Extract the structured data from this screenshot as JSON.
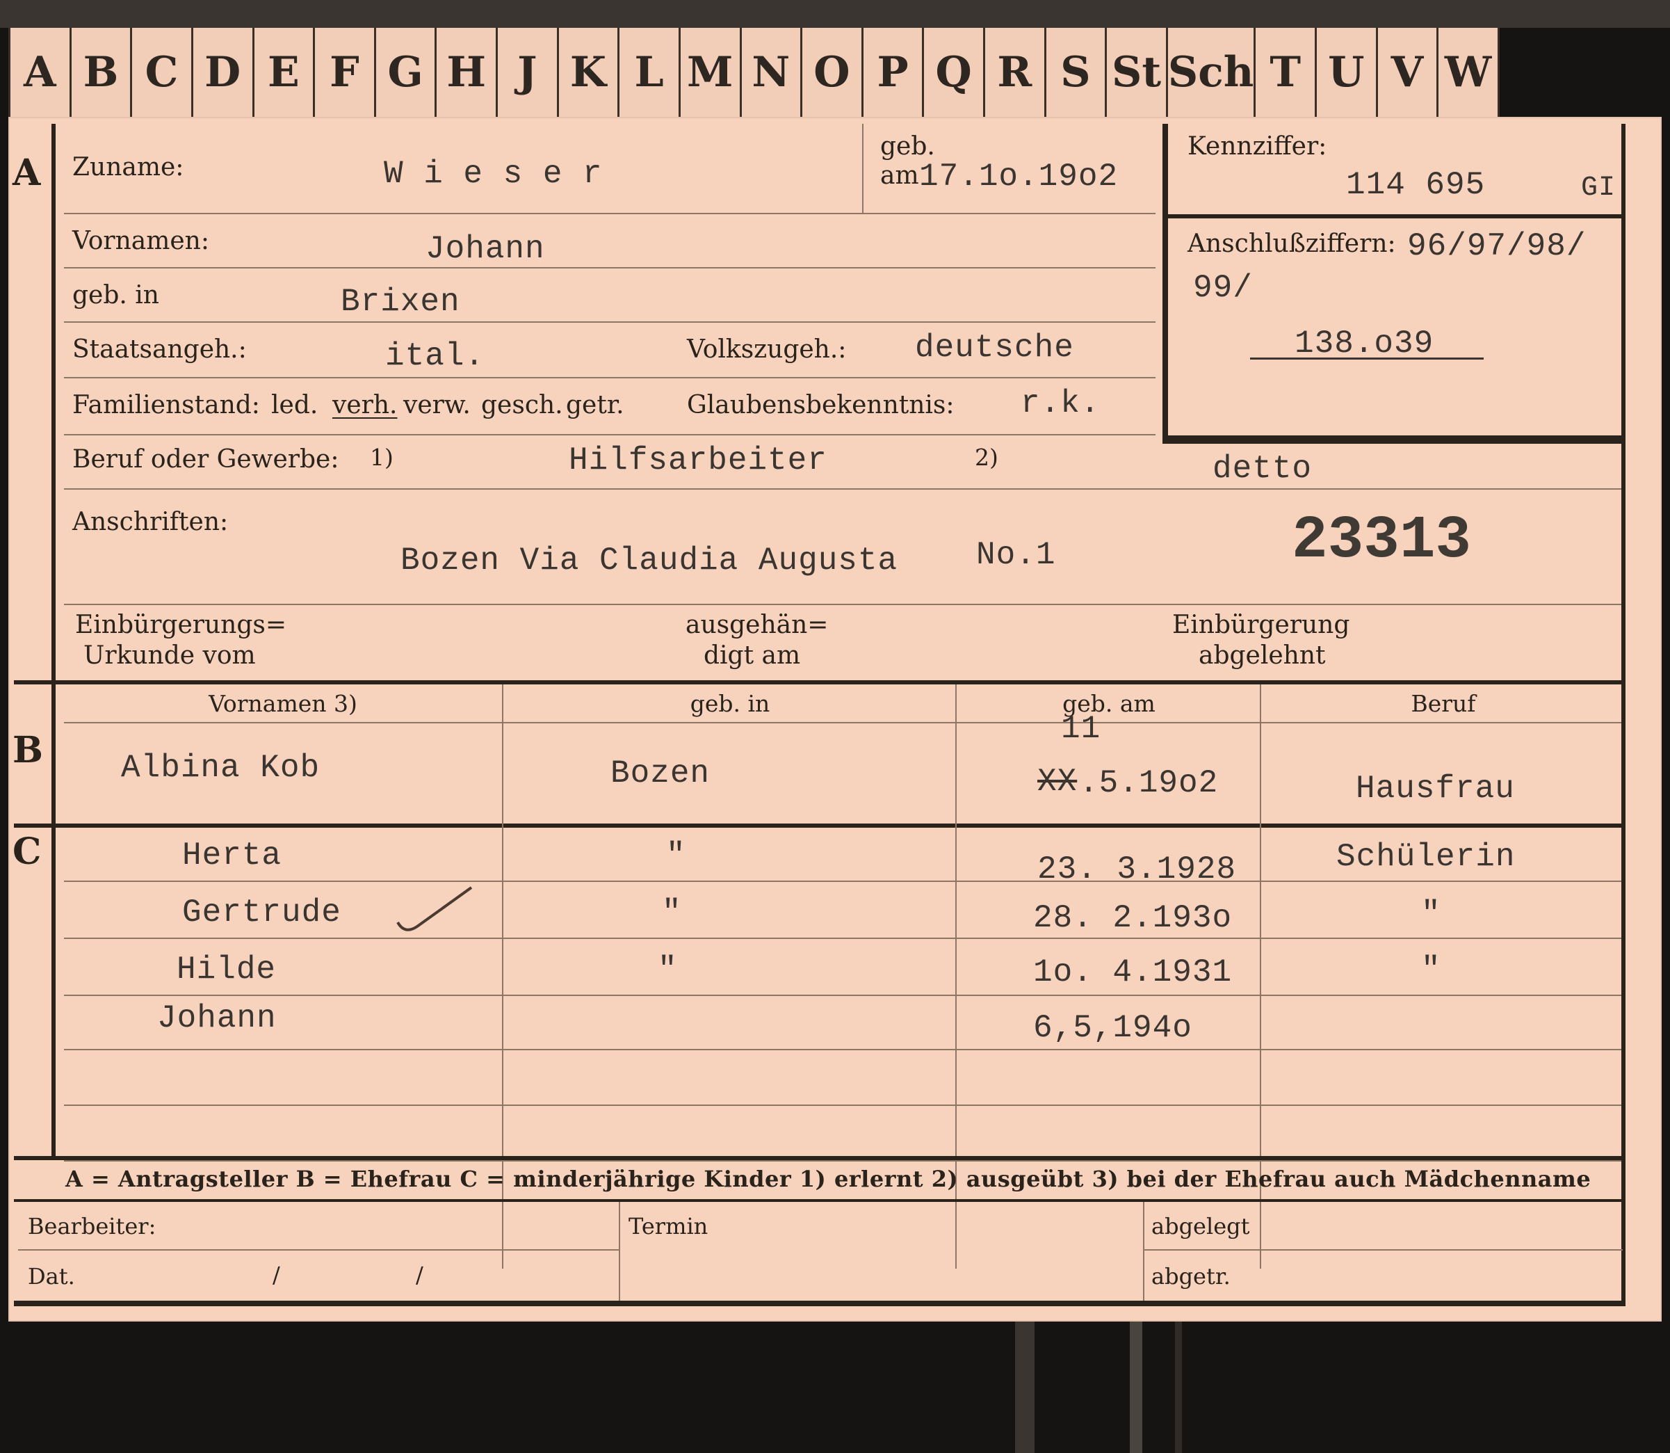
{
  "tabs": [
    "A",
    "B",
    "C",
    "D",
    "E",
    "F",
    "G",
    "H",
    "J",
    "K",
    "L",
    "M",
    "N",
    "O",
    "P",
    "Q",
    "R",
    "S",
    "St",
    "Sch",
    "T",
    "U",
    "V",
    "W"
  ],
  "section_a": {
    "letter": "A",
    "surname_label": "Zuname:",
    "surname": "W i e s e r",
    "born_label_1": "geb.",
    "born_label_2": "am",
    "born_date": "17.1o.19o2",
    "kennziffer_label": "Kennziffer:",
    "kennziffer": "114 695",
    "kennziffer_suffix": "GI",
    "anschluss_label": "Anschlußziffern:",
    "anschluss_1": "96/97/98/",
    "anschluss_2": "99/",
    "anschluss_3": "138.o39",
    "vornamen_label": "Vornamen:",
    "vornamen": "Johann",
    "birthplace_label": "geb. in",
    "birthplace": "Brixen",
    "citizenship_label": "Staatsangeh.:",
    "citizenship": "ital.",
    "ethnicity_label": "Volkszugeh.:",
    "ethnicity": "deutsche",
    "marital_label": "Familienstand:",
    "marital_options": [
      "led.",
      "verh.",
      "verw.",
      "gesch.",
      "getr."
    ],
    "religion_label": "Glaubensbekenntnis:",
    "religion": "r.k.",
    "occupation_label": "Beruf oder Gewerbe:",
    "occ_note_1": "1)",
    "occupation_learned": "Hilfsarbeiter",
    "occ_note_2": "2)",
    "occupation_practiced": "detto",
    "address_label": "Anschriften:",
    "address": "Bozen Via Claudia Augusta",
    "address_no": "No.1",
    "stamp_number": "23313",
    "naturalization_label_1": "Einbürgerungs=",
    "naturalization_label_2": "Urkunde vom",
    "handed_label_1": "ausgehän=",
    "handed_label_2": "digt am",
    "refused_label_1": "Einbürgerung",
    "refused_label_2": "abgelehnt"
  },
  "section_b": {
    "letter": "B",
    "headers": [
      "Vornamen 3)",
      "geb. in",
      "geb. am",
      "Beruf"
    ],
    "wife": {
      "name": "Albina Kob",
      "birthplace": "Bozen",
      "birthdate_correction": "11",
      "birthdate_struck": "XX",
      "birthdate": ".5.19o2",
      "occupation": "Hausfrau"
    }
  },
  "section_c": {
    "letter": "C",
    "children": [
      {
        "name": "Herta",
        "birthplace": "\"",
        "birthdate": "23. 3.1928",
        "occupation": "Schülerin"
      },
      {
        "name": "Gertrude",
        "birthplace": "\"",
        "birthdate": "28. 2.193o",
        "occupation": "\""
      },
      {
        "name": "Hilde",
        "birthplace": "\"",
        "birthdate": "1o. 4.1931",
        "occupation": "\""
      },
      {
        "name": "Johann",
        "birthplace": "",
        "birthdate": "6,5,194o",
        "occupation": ""
      }
    ]
  },
  "legend": "A = Antragsteller   B = Ehefrau   C = minderjährige Kinder   1) erlernt   2) ausgeübt   3) bei der Ehefrau auch Mädchenname",
  "footer": {
    "clerk_label": "Bearbeiter:",
    "date_label": "Dat.",
    "date_sep_1": "/",
    "date_sep_2": "/",
    "deadline_label": "Termin",
    "filed_label": "abgelegt",
    "filed_label_2": "abgetr."
  }
}
